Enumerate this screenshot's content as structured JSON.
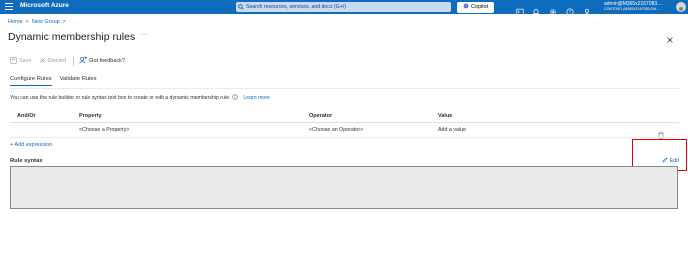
{
  "topbar": {
    "brand": "Microsoft Azure",
    "search_placeholder": "Search resources, services, and docs (G+/)",
    "copilot_label": "Copilot",
    "account_name": "admin@M365x2167083....",
    "account_tenant": "CONTOSO (M365X2167083.ON...",
    "icons": [
      "cloud-shell-icon",
      "notifications-icon",
      "settings-icon",
      "help-icon",
      "feedback-icon"
    ]
  },
  "breadcrumb": {
    "home": "Home",
    "group": "New Group",
    "sep": ">"
  },
  "page": {
    "title": "Dynamic membership rules",
    "more": "···"
  },
  "toolbar": {
    "save": "Save",
    "discard": "Discard",
    "feedback": "Got feedback?"
  },
  "tabs": [
    {
      "label": "Configure Rules",
      "active": true
    },
    {
      "label": "Validate Rules",
      "active": false
    }
  ],
  "description": {
    "text": "You can use the rule builder or rule syntax text box to create or edit a dynamic membership rule.",
    "link": "Learn more"
  },
  "table": {
    "headers": [
      "And/Or",
      "Property",
      "Operator",
      "Value"
    ],
    "rows": [
      {
        "and_or": "",
        "property": "<Choose a Property>",
        "operator": "<Choose an Operator>",
        "value": "Add a value"
      }
    ]
  },
  "add_expression": "+ Add expression",
  "rule_syntax": {
    "label": "Rule syntax",
    "edit": "Edit",
    "value": ""
  },
  "colors": {
    "brand": "#0f6cbd",
    "highlight": "#e00000"
  }
}
